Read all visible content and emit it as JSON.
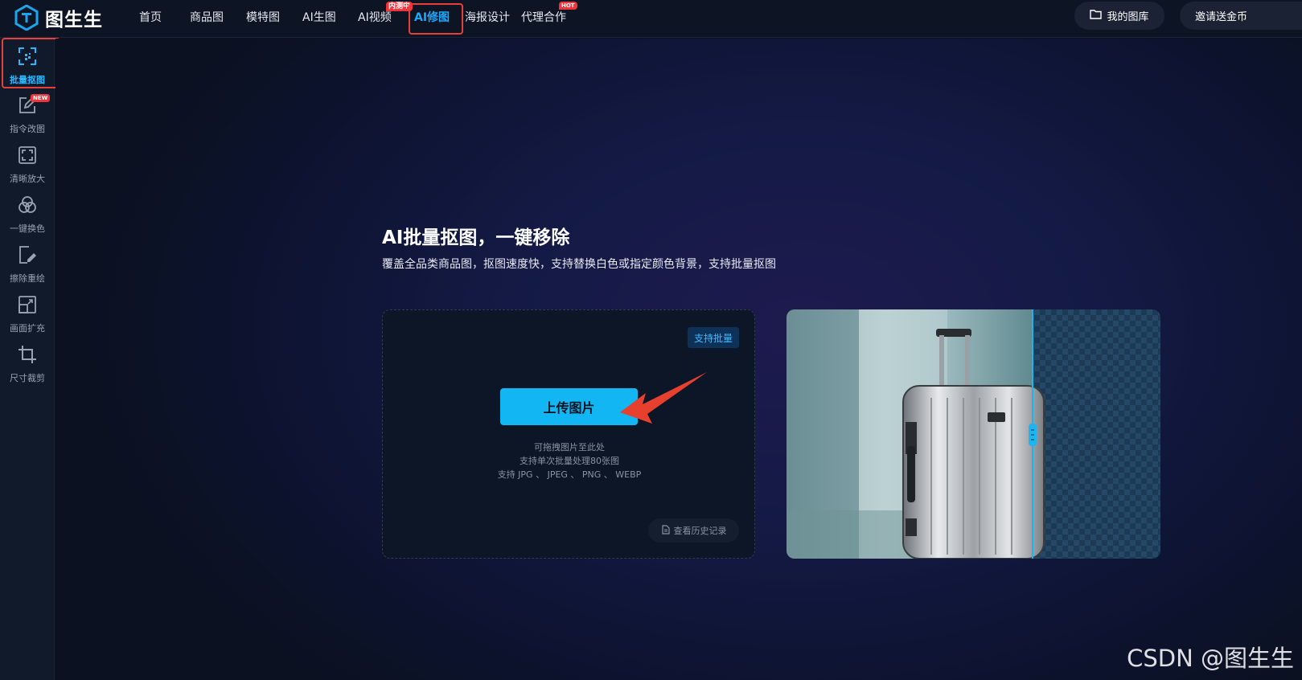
{
  "brand": {
    "name": "图生生"
  },
  "nav": [
    {
      "label": "首页"
    },
    {
      "label": "商品图"
    },
    {
      "label": "模特图"
    },
    {
      "label": "AI生图"
    },
    {
      "label": "AI视频",
      "tag": "内测中"
    },
    {
      "label": "AI修图",
      "active": true
    },
    {
      "label": "海报设计"
    },
    {
      "label": "代理合作",
      "tag": "HOT"
    }
  ],
  "top_buttons": {
    "library": "我的图库",
    "invite": "邀请送金币"
  },
  "sidebar": [
    {
      "label": "批量抠图",
      "icon": "cutout-icon",
      "active": true
    },
    {
      "label": "指令改图",
      "icon": "edit-icon",
      "badge": "NEW"
    },
    {
      "label": "清晰放大",
      "icon": "upscale-icon"
    },
    {
      "label": "一键换色",
      "icon": "color-icon"
    },
    {
      "label": "擦除重绘",
      "icon": "eraser-icon"
    },
    {
      "label": "画面扩充",
      "icon": "expand-icon"
    },
    {
      "label": "尺寸裁剪",
      "icon": "crop-icon"
    }
  ],
  "main": {
    "title": "AI批量抠图，一键移除",
    "subtitle": "覆盖全品类商品图，抠图速度快，支持替换白色或指定颜色背景，支持批量抠图",
    "upload": {
      "badge": "支持批量",
      "button": "上传图片",
      "hint1": "可拖拽图片至此处",
      "hint2": "支持单次批量处理80张图",
      "hint3": "支持 JPG 、 JPEG 、 PNG 、 WEBP",
      "history": "查看历史记录"
    }
  },
  "watermark": "CSDN @图生生",
  "colors": {
    "accent": "#17a9ff",
    "highlight": "#e6403a",
    "button": "#12b6f2"
  }
}
